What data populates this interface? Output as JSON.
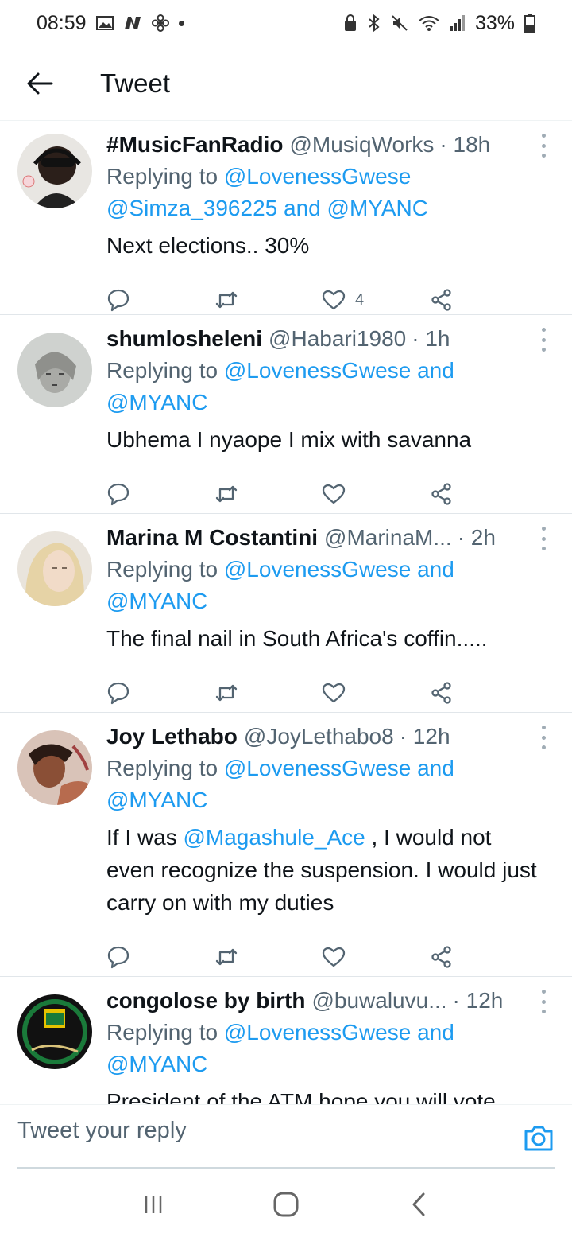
{
  "status_bar": {
    "time": "08:59",
    "battery": "33%",
    "icons_left": [
      "gallery-icon",
      "n-icon",
      "fan-icon",
      "dot"
    ],
    "icons_right": [
      "lock-icon",
      "bluetooth-icon",
      "mute-icon",
      "wifi-icon",
      "signal-icon",
      "battery-icon"
    ]
  },
  "header": {
    "title": "Tweet"
  },
  "tweets": [
    {
      "name": "#MusicFanRadio",
      "handle": "@MusiqWorks",
      "time": "· 18h",
      "reply_prefix": "Replying to ",
      "reply_mentions_line1": "@LovenessGwese",
      "reply_mentions_line2a": "@Simza_396225",
      "reply_and": " and ",
      "reply_mentions_line2b": "@MYANC",
      "text": "Next elections.. 30%",
      "like_count": "4"
    },
    {
      "name": "shumlosheleni",
      "handle": "@Habari1980",
      "time": "· 1h",
      "reply_prefix": "Replying to ",
      "reply_mention_1": "@LovenessGwese and",
      "reply_mention_2": "@MYANC",
      "text": "Ubhema I nyaope I mix with savanna",
      "like_count": ""
    },
    {
      "name": "Marina M Costantini",
      "handle": "@MarinaM...",
      "time": "· 2h",
      "reply_prefix": "Replying to ",
      "reply_mention_1": "@LovenessGwese and",
      "reply_mention_2": "@MYANC",
      "text": "The final nail in South Africa's coffin.....",
      "like_count": ""
    },
    {
      "name": "Joy Lethabo",
      "handle": "@JoyLethabo8",
      "time": "· 12h",
      "reply_prefix": "Replying to ",
      "reply_mention_1": "@LovenessGwese and",
      "reply_mention_2": "@MYANC",
      "text_before": "If I was ",
      "text_mention": "@Magashule_Ace",
      "text_after": " , I would not even recognize the suspension. I would just carry on with my duties",
      "like_count": ""
    },
    {
      "name": "congolose by birth",
      "handle": "@buwaluvu...",
      "time": "· 12h",
      "reply_prefix": "Replying to ",
      "reply_mention_1": "@LovenessGwese and",
      "reply_mention_2": "@MYANC",
      "text": "President of the ATM hope you will vote",
      "like_count": ""
    }
  ],
  "reply_bar": {
    "placeholder": "Tweet your reply"
  },
  "colors": {
    "link": "#1d9bf0",
    "secondary": "#536471",
    "text": "#0f1419"
  }
}
